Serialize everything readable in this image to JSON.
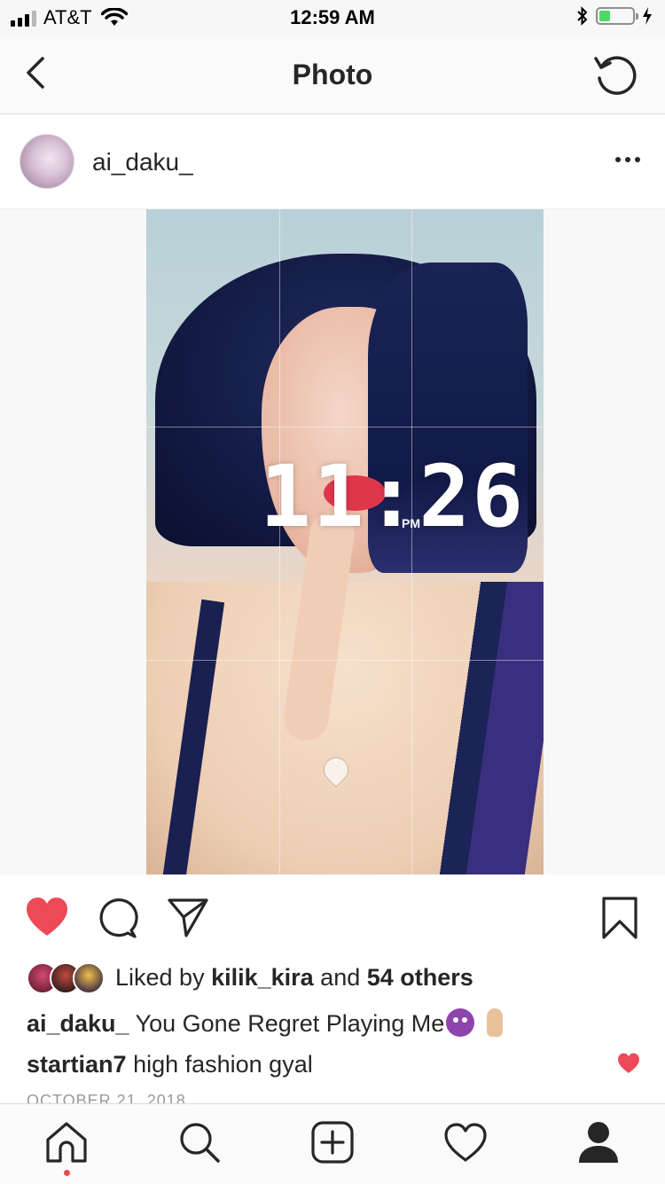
{
  "status_bar": {
    "carrier": "AT&T",
    "time": "12:59 AM",
    "battery_color": "#4cd964"
  },
  "nav": {
    "title": "Photo",
    "back_icon": "chevron-left-icon",
    "right_icon": "refresh-icon"
  },
  "post": {
    "username": "ai_daku_",
    "more_icon": "more-horizontal-icon",
    "photo_overlay": {
      "time": "11:26",
      "ampm": "PM"
    },
    "liked": true,
    "like_color": "#ed4956",
    "likes": {
      "prefix": "Liked by ",
      "user": "kilik_kira",
      "middle": " and ",
      "others": "54 others"
    },
    "caption": {
      "user": "ai_daku_",
      "text": " You Gone Regret Playing Me"
    },
    "comments": [
      {
        "user": "startian7",
        "text": " high fashion gyal",
        "liked": true
      }
    ],
    "date": "OCTOBER 21, 2018"
  },
  "tab_bar": {
    "items": [
      "home-icon",
      "search-icon",
      "add-post-icon",
      "activity-heart-icon",
      "profile-icon"
    ],
    "active": "home-icon",
    "notification_color": "#ed4956"
  }
}
